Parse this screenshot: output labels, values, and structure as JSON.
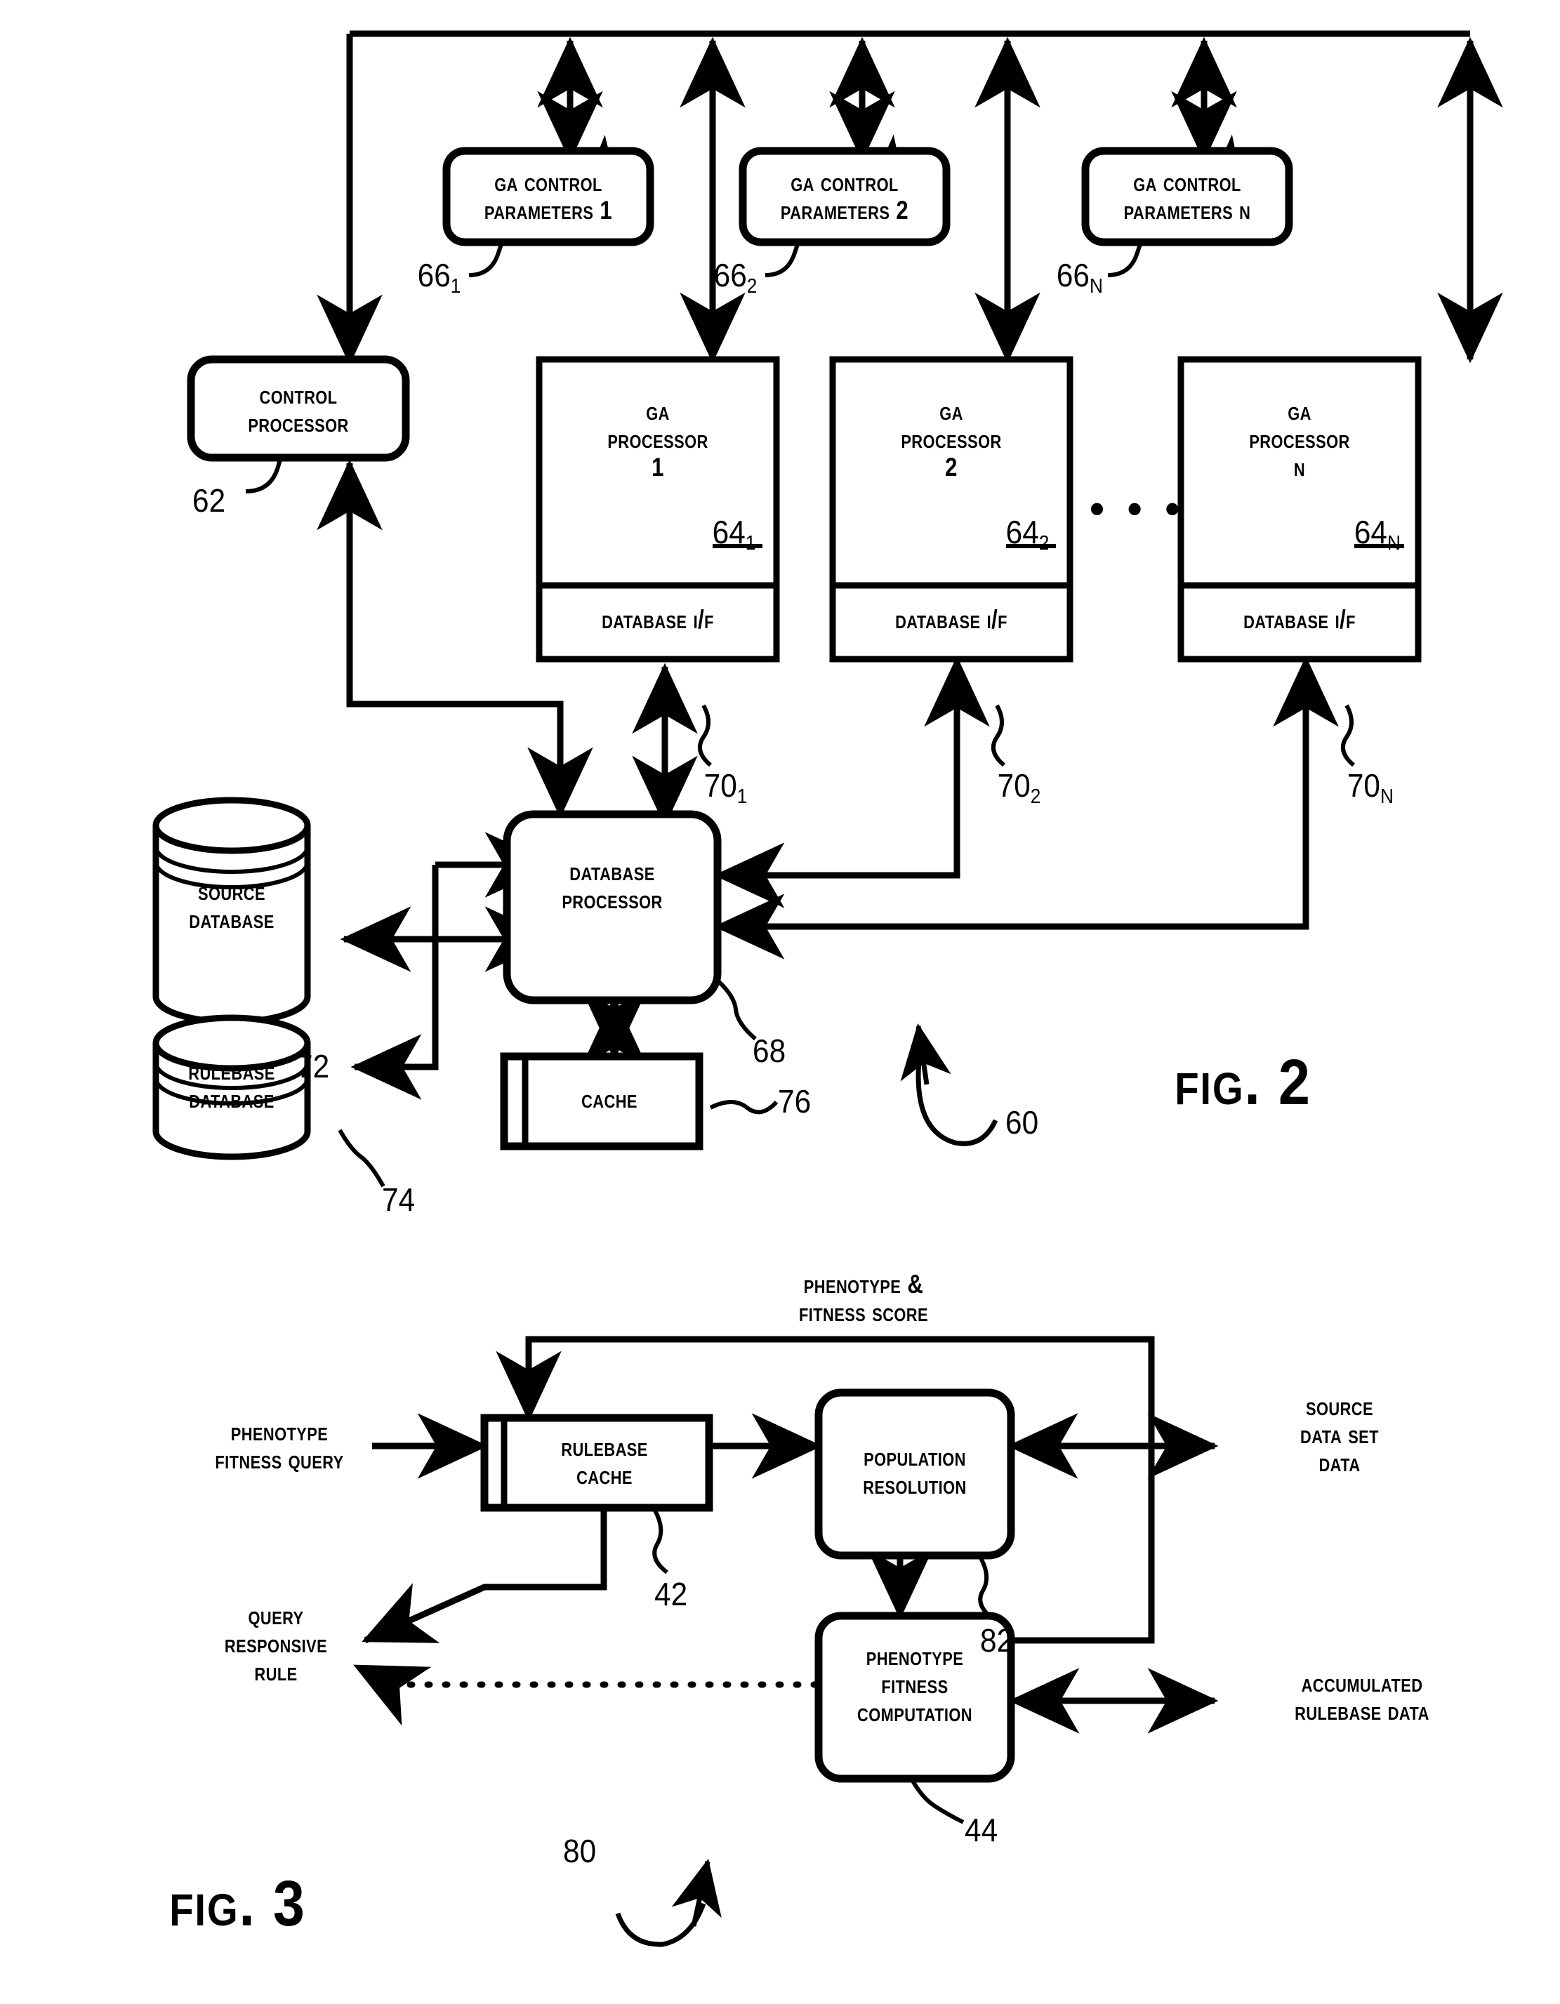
{
  "figure2": {
    "fig_label": "FIG. 2",
    "fig_ref": "60",
    "boxes": {
      "ga_control_1": {
        "line1": "GA Control",
        "line2": "Parameters 1",
        "ref": "66",
        "ref_sub": "1"
      },
      "ga_control_2": {
        "line1": "GA Control",
        "line2": "Parameters 2",
        "ref": "66",
        "ref_sub": "2"
      },
      "ga_control_n": {
        "line1": "GA Control",
        "line2": "Parameters N",
        "ref": "66",
        "ref_sub": "N"
      },
      "control_processor": {
        "line1": "Control",
        "line2": "Processor",
        "ref": "62"
      },
      "ga_processor_1": {
        "line1": "GA",
        "line2": "Processor",
        "line3": "1",
        "ref": "64",
        "ref_sub": "1",
        "io_label": "Database I/F",
        "io_ref": "70",
        "io_ref_sub": "1"
      },
      "ga_processor_2": {
        "line1": "GA",
        "line2": "Processor",
        "line3": "2",
        "ref": "64",
        "ref_sub": "2",
        "io_label": "Database I/F",
        "io_ref": "70",
        "io_ref_sub": "2"
      },
      "ga_processor_n": {
        "line1": "GA",
        "line2": "Processor",
        "line3": "N",
        "ref": "64",
        "ref_sub": "N",
        "io_label": "Database I/F",
        "io_ref": "70",
        "io_ref_sub": "N"
      },
      "database_processor": {
        "line1": "Database",
        "line2": "Processor",
        "ref": "68"
      },
      "source_database": {
        "line1": "Source",
        "line2": "Database",
        "ref": "72"
      },
      "rulebase_database": {
        "line1": "Rulebase",
        "line2": "Database",
        "ref": "74"
      },
      "cache": {
        "line1": "Cache",
        "ref": "76"
      }
    },
    "ellipsis": "• • •"
  },
  "figure3": {
    "fig_label": "FIG. 3",
    "fig_ref": "80",
    "boxes": {
      "rulebase_cache": {
        "line1": "Rulebase",
        "line2": "Cache",
        "ref": "42"
      },
      "population_resolution": {
        "line1": "Population",
        "line2": "Resolution",
        "ref": "82"
      },
      "phenotype_fitness_computation": {
        "line1": "Phenotype",
        "line2": "Fitness",
        "line3": "Computation",
        "ref": "44"
      }
    },
    "labels": {
      "feedback": {
        "line1": "Phenotype &",
        "line2": "Fitness Score"
      },
      "input_query": {
        "line1": "Phenotype",
        "line2": "Fitness Query"
      },
      "output_rule": {
        "line1": "Query",
        "line2": "Responsive",
        "line3": "Rule"
      },
      "source_data": {
        "line1": "Source",
        "line2": "Data Set",
        "line3": "Data"
      },
      "accumulated_rulebase": {
        "line1": "Accumulated",
        "line2": "Rulebase Data"
      }
    }
  },
  "style": {
    "ink": "#000000",
    "paper": "#ffffff"
  }
}
